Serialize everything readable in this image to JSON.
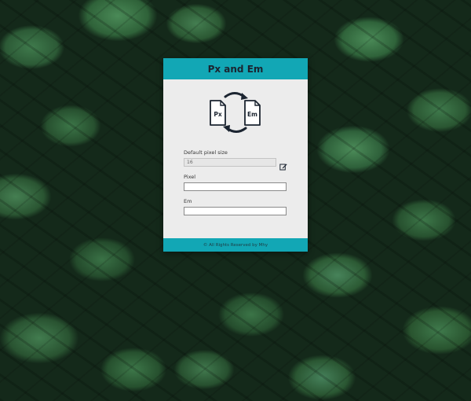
{
  "app": {
    "title": "Px and Em"
  },
  "logo": {
    "icon": "px-em-conversion-icon",
    "left_doc_label": "Px",
    "right_doc_label": "Em"
  },
  "fields": {
    "default_size": {
      "label": "Default pixel size",
      "value": "16"
    },
    "pixel": {
      "label": "Pixel",
      "value": ""
    },
    "em": {
      "label": "Em",
      "value": ""
    }
  },
  "edit": {
    "icon": "edit-icon"
  },
  "footer": {
    "text": "© All Rights Reserved by Mhy"
  },
  "colors": {
    "accent": "#12a7b5",
    "card_background": "#ececec",
    "title_text": "#1b2430"
  }
}
